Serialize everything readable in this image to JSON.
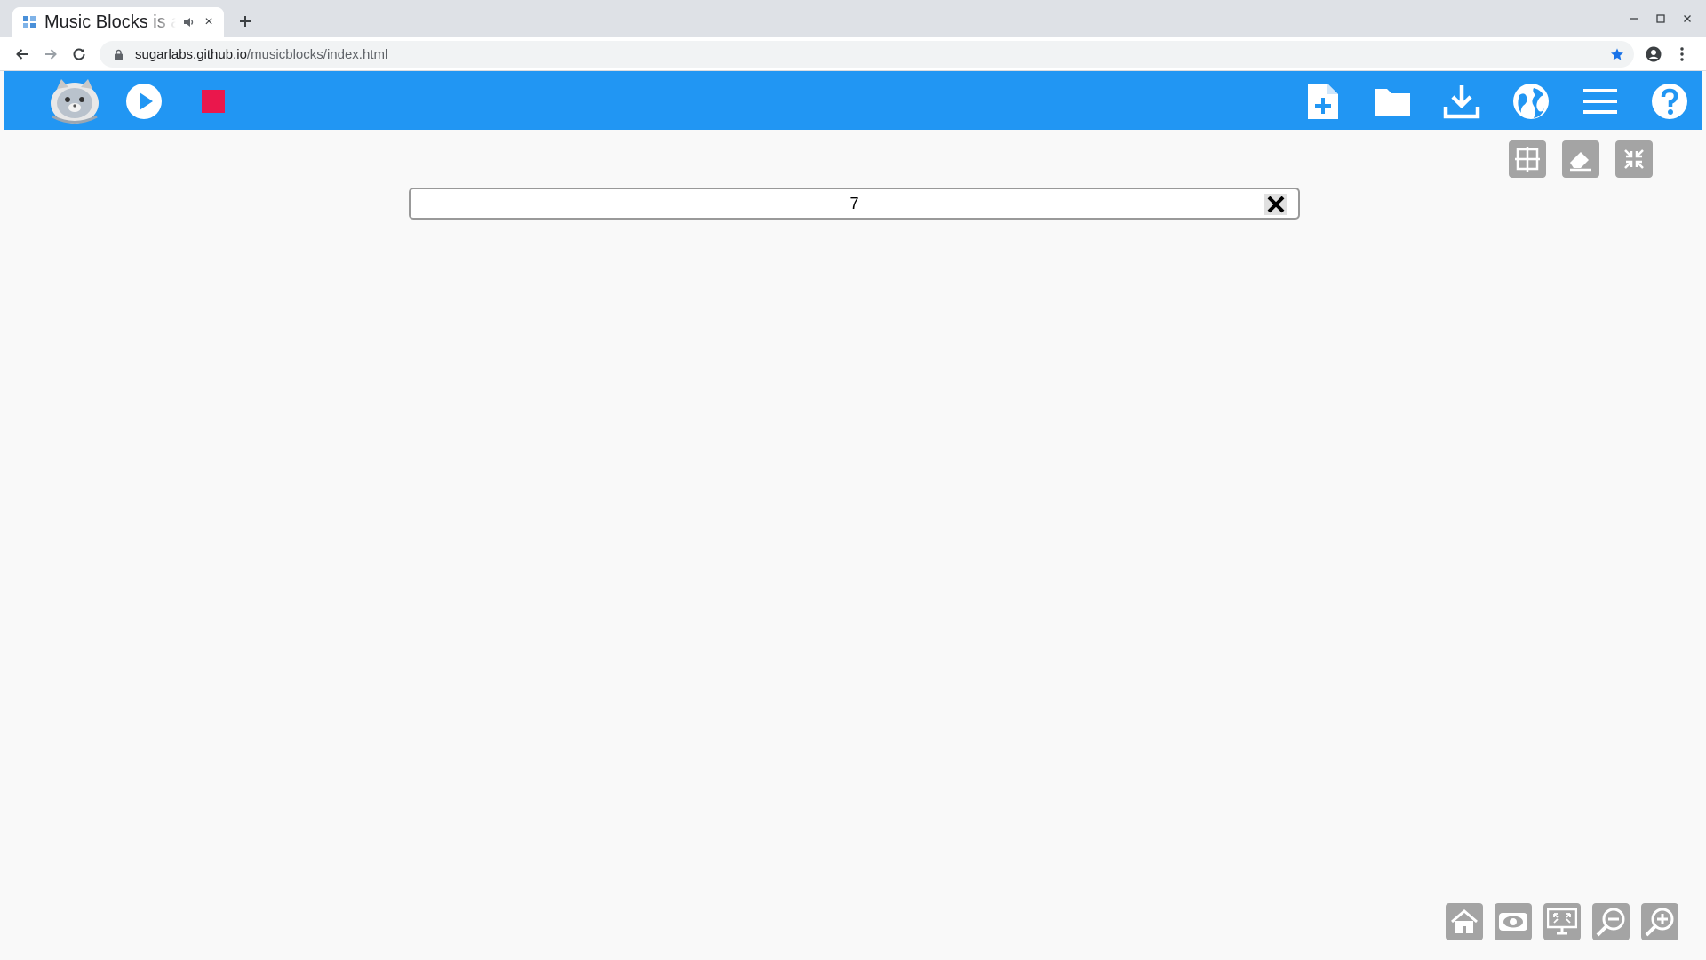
{
  "browser": {
    "tab_title": "Music Blocks is a",
    "tab_close": "×",
    "new_tab": "+",
    "url_host": "sugarlabs.github.io",
    "url_path": "/musicblocks/index.html"
  },
  "app": {
    "toolbar": {
      "accent_color": "#2196f3",
      "left": [
        "logo-mascot-icon",
        "play-icon",
        "stop-icon"
      ],
      "right": [
        "new-project-icon",
        "open-folder-icon",
        "download-icon",
        "globe-icon",
        "menu-icon",
        "help-icon"
      ]
    },
    "aux_buttons": [
      "grid-icon",
      "eraser-icon",
      "collapse-icon"
    ],
    "search": {
      "value": "7",
      "close_label": "✕"
    },
    "bottom_buttons": [
      "home-icon",
      "eye-icon",
      "expand-blocks-icon",
      "zoom-out-icon",
      "zoom-in-icon"
    ]
  }
}
